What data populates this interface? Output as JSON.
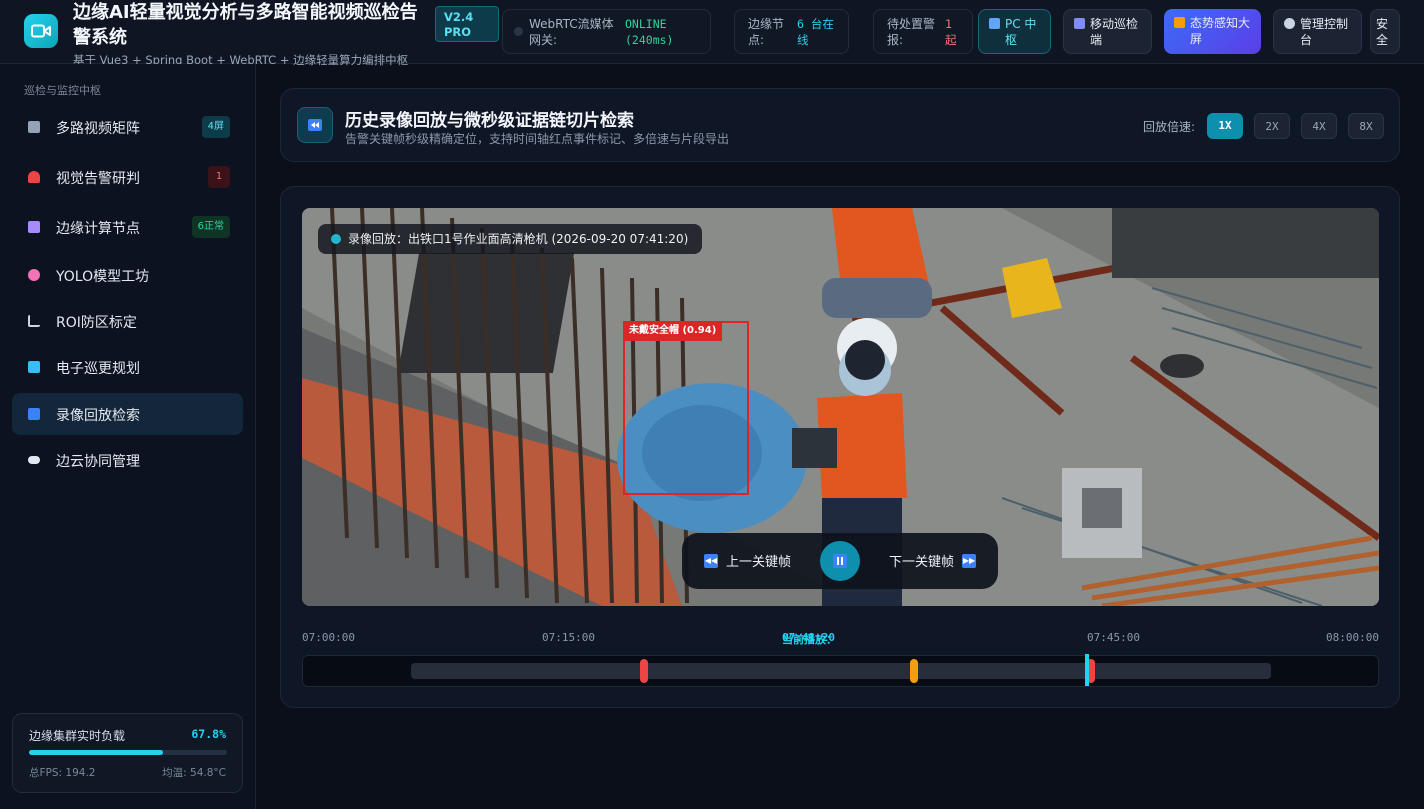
{
  "header": {
    "title": "边缘AI轻量视觉分析与多路智能视频巡检告警系统",
    "subtitle": "基于 Vue3 + Spring Boot + WebRTC + 边缘轻量算力编排中枢",
    "version": "V2.4 PRO",
    "stats": {
      "gateway_label": "WebRTC流媒体网关:",
      "gateway_value": "ONLINE (240ms)",
      "nodes_label": "边缘节点:",
      "nodes_value": "6 台在线",
      "alarms_label": "待处置警报:",
      "alarms_value": "1 起"
    },
    "nav_buttons": {
      "pc": "PC 中枢",
      "mobile": "移动巡检端",
      "screen": "态势感知大屏",
      "admin": "管理控制台",
      "security": "安全"
    }
  },
  "sidebar": {
    "section_title": "巡检与监控中枢",
    "items": [
      {
        "label": "多路视频矩阵",
        "badge": "4屏"
      },
      {
        "label": "视觉告警研判",
        "badge": "1"
      },
      {
        "label": "边缘计算节点",
        "badge": "6正常"
      },
      {
        "label": "YOLO模型工坊",
        "badge": ""
      },
      {
        "label": "ROI防区标定",
        "badge": ""
      },
      {
        "label": "电子巡更规划",
        "badge": ""
      },
      {
        "label": "录像回放检索",
        "badge": ""
      },
      {
        "label": "边云协同管理",
        "badge": ""
      }
    ],
    "load": {
      "label": "边缘集群实时负载",
      "value": "67.8%",
      "fraction": 0.678,
      "fps": "总FPS: 194.2",
      "temp": "均温: 54.8°C"
    }
  },
  "main": {
    "title": "历史录像回放与微秒级证据链切片检索",
    "subtitle": "告警关键帧秒级精确定位，支持时间轴红点事件标记、多倍速与片段导出",
    "speed_label": "回放倍速:",
    "speeds": [
      "1X",
      "2X",
      "4X",
      "8X"
    ],
    "speed_selected": "1X",
    "video": {
      "caption": "录像回放：出铁口1号作业面高清枪机 (2026-09-20 07:41:20)",
      "detection_label": "未戴安全帽 (0.94)",
      "prev_label": "上一关键帧",
      "next_label": "下一关键帧"
    },
    "timeline": {
      "ticks": [
        "07:00:00",
        "07:15:00",
        "07:45:00",
        "08:00:00"
      ],
      "current_label": "当前播放：",
      "current_time": "07:41:20",
      "markers": [
        {
          "color": "#ef4444",
          "position": 0.317
        },
        {
          "color": "#f59e0b",
          "position": 0.567
        },
        {
          "color": "#ef4444",
          "position": 0.732
        }
      ],
      "playhead_position": 0.728
    }
  },
  "colors": {
    "accent": "#22d3ee",
    "alert": "#ef4444",
    "warning": "#f59e0b",
    "primary_button": "#4f46e5"
  }
}
